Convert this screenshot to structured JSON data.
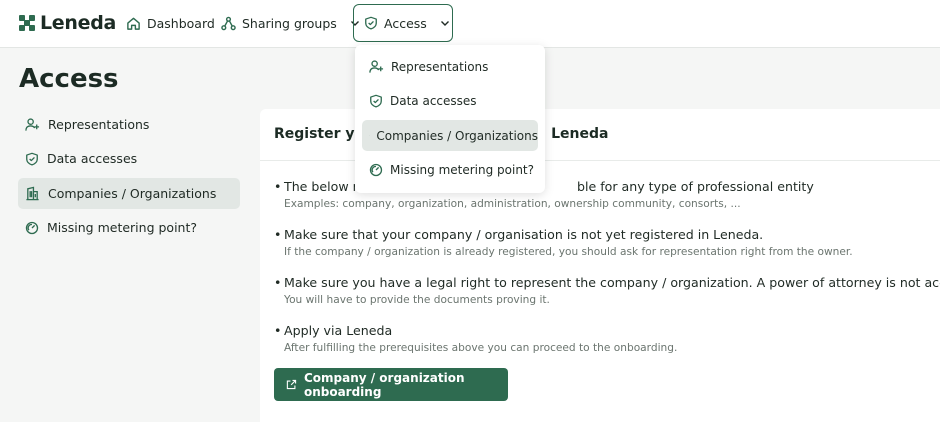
{
  "app": {
    "name": "Leneda"
  },
  "nav": {
    "dashboard": "Dashboard",
    "sharing_groups": "Sharing groups",
    "access": "Access"
  },
  "access_menu": {
    "items": [
      {
        "label": "Representations",
        "icon": "user-plus-icon"
      },
      {
        "label": "Data accesses",
        "icon": "shield-check-icon"
      },
      {
        "label": "Companies / Organizations",
        "icon": "building-icon",
        "active": true
      },
      {
        "label": "Missing metering point?",
        "icon": "gauge-icon"
      }
    ]
  },
  "page": {
    "title": "Access"
  },
  "sidebar": {
    "items": [
      {
        "label": "Representations",
        "icon": "user-plus-icon"
      },
      {
        "label": "Data accesses",
        "icon": "shield-check-icon"
      },
      {
        "label": "Companies / Organizations",
        "icon": "building-icon",
        "active": true
      },
      {
        "label": "Missing metering point?",
        "icon": "gauge-icon"
      }
    ]
  },
  "card": {
    "title_start": "Register you",
    "title_end": "Leneda",
    "bullets": [
      {
        "main": "The below m",
        "main_end": "ble for any type of professional entity",
        "sub": "Examples: company, organization, administration, ownership community, consorts, ..."
      },
      {
        "main": "Make sure that your company / organisation is not yet registered in Leneda.",
        "sub": "If the company / organization is already registered, you should ask for representation right from the owner."
      },
      {
        "main": "Make sure you have a legal right to represent the company / organization. A power of attorney is not accepted.",
        "sub": "You will have to provide the documents proving it."
      },
      {
        "main": "Apply via Leneda",
        "sub": "After fulfilling the prerequisites above you can proceed to the onboarding."
      }
    ],
    "onboarding_button": "Company / organization onboarding"
  },
  "colors": {
    "brand": "#2e6b50",
    "active_bg": "#e2e7e4",
    "background": "#f5f6f5"
  }
}
